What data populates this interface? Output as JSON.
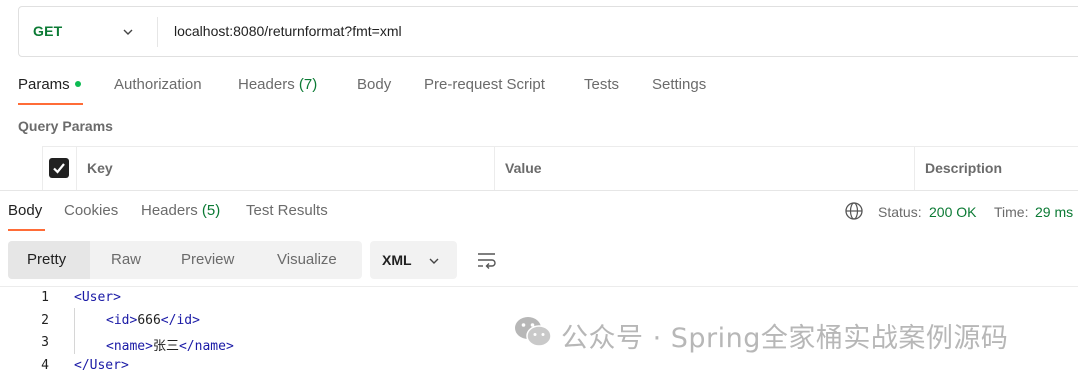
{
  "request": {
    "method": "GET",
    "url": "localhost:8080/returnformat?fmt=xml"
  },
  "request_tabs": [
    {
      "label": "Params",
      "active": true,
      "dot": true
    },
    {
      "label": "Authorization"
    },
    {
      "label": "Headers",
      "count": "(7)"
    },
    {
      "label": "Body"
    },
    {
      "label": "Pre-request Script"
    },
    {
      "label": "Tests"
    },
    {
      "label": "Settings"
    }
  ],
  "query_params": {
    "title": "Query Params",
    "columns": [
      "Key",
      "Value",
      "Description"
    ]
  },
  "response_tabs": [
    {
      "label": "Body",
      "active": true
    },
    {
      "label": "Cookies"
    },
    {
      "label": "Headers",
      "count": "(5)"
    },
    {
      "label": "Test Results"
    }
  ],
  "response_status": {
    "status_label": "Status:",
    "status_value": "200 OK",
    "time_label": "Time:",
    "time_value": "29 ms"
  },
  "view_modes": [
    "Pretty",
    "Raw",
    "Preview",
    "Visualize"
  ],
  "format": "XML",
  "code_lines": [
    {
      "n": "1",
      "open": "<User>",
      "text": "",
      "close": ""
    },
    {
      "n": "2",
      "open": "<id>",
      "text": "666",
      "close": "</id>"
    },
    {
      "n": "3",
      "open": "<name>",
      "text": "张三",
      "close": "</name>"
    },
    {
      "n": "4",
      "open": "</User>",
      "text": "",
      "close": ""
    }
  ],
  "watermark": "公众号 · Spring全家桶实战案例源码",
  "colors": {
    "accent": "#ff6c37",
    "method_green": "#0b7a34",
    "status_dot": "#0cbb52",
    "xml_tag": "#1a1aa6"
  }
}
